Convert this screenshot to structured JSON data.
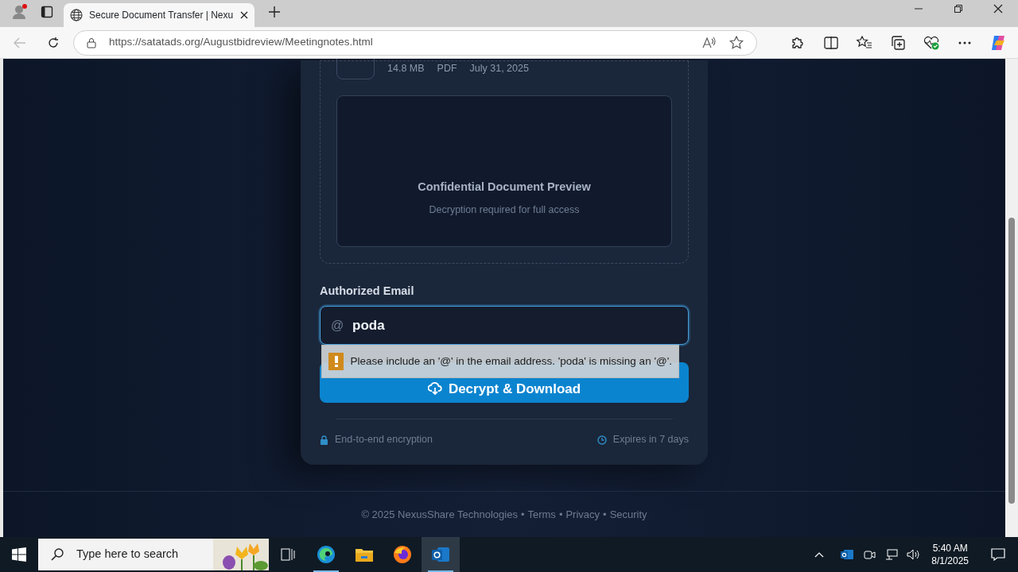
{
  "browser": {
    "tab_title": "Secure Document Transfer | Nexu",
    "url": "https://satatads.org/Augustbidreview/Meetingnotes.html"
  },
  "file": {
    "meta": [
      "14.8 MB",
      "PDF",
      "July 31, 2025"
    ]
  },
  "preview": {
    "title": "Confidential Document Preview",
    "subtitle": "Decryption required for full access"
  },
  "email": {
    "label": "Authorized Email",
    "prefix": "@",
    "value": "poda",
    "validation_message": "Please include an '@' in the email address. 'poda' is missing an '@'."
  },
  "submit_button": "Decrypt & Download",
  "features": [
    {
      "kind": "lock",
      "label": "End-to-end encryption"
    },
    {
      "kind": "clock",
      "label": "Expires in 7 days"
    }
  ],
  "footer": {
    "copyright": "© 2025 NexusShare Technologies",
    "links": [
      "Terms",
      "Privacy",
      "Security"
    ],
    "separator": "•"
  },
  "taskbar": {
    "search_placeholder": "Type here to search",
    "apps": [
      {
        "kind": "taskview",
        "open": false,
        "selected": false
      },
      {
        "kind": "edge",
        "open": true,
        "selected": false
      },
      {
        "kind": "explorer",
        "open": false,
        "selected": false
      },
      {
        "kind": "firefox",
        "open": false,
        "selected": false
      },
      {
        "kind": "outlook",
        "open": true,
        "selected": true
      }
    ],
    "time": "5:40 AM",
    "date": "8/1/2025"
  }
}
